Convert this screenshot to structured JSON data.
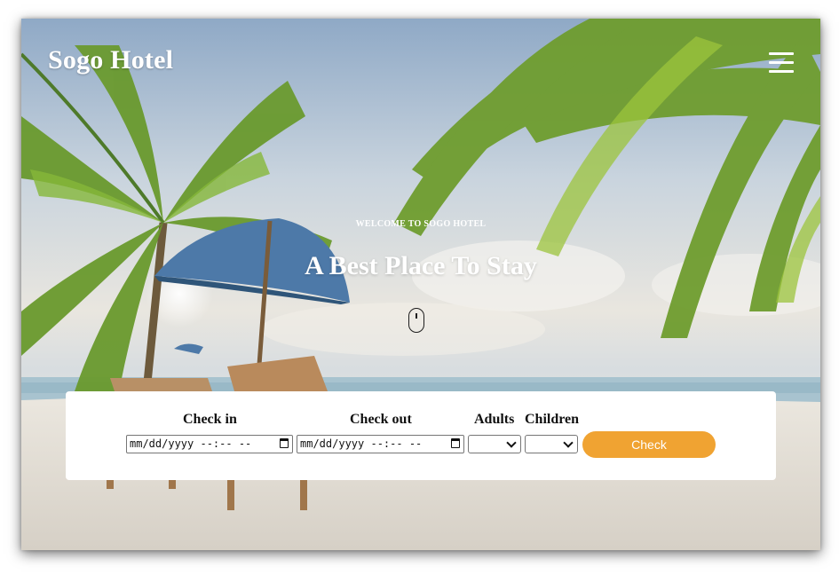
{
  "header": {
    "brand": "Sogo Hotel",
    "menu_icon": "hamburger-menu-icon"
  },
  "hero": {
    "welcome": "WELCOME TO SOGO HOTEL",
    "title": "A Best Place To Stay",
    "scroll_icon": "mouse-scroll-icon"
  },
  "booking": {
    "check_in_label": "Check in",
    "check_out_label": "Check out",
    "adults_label": "Adults",
    "children_label": "Children",
    "check_in_value": "mm/dd/yyyy --:-- --",
    "check_out_value": "mm/dd/yyyy --:-- --",
    "adults_value": "",
    "children_value": "",
    "button_label": "Check"
  },
  "colors": {
    "accent": "#f0a332",
    "panel": "#ffffff",
    "text": "#111111"
  }
}
